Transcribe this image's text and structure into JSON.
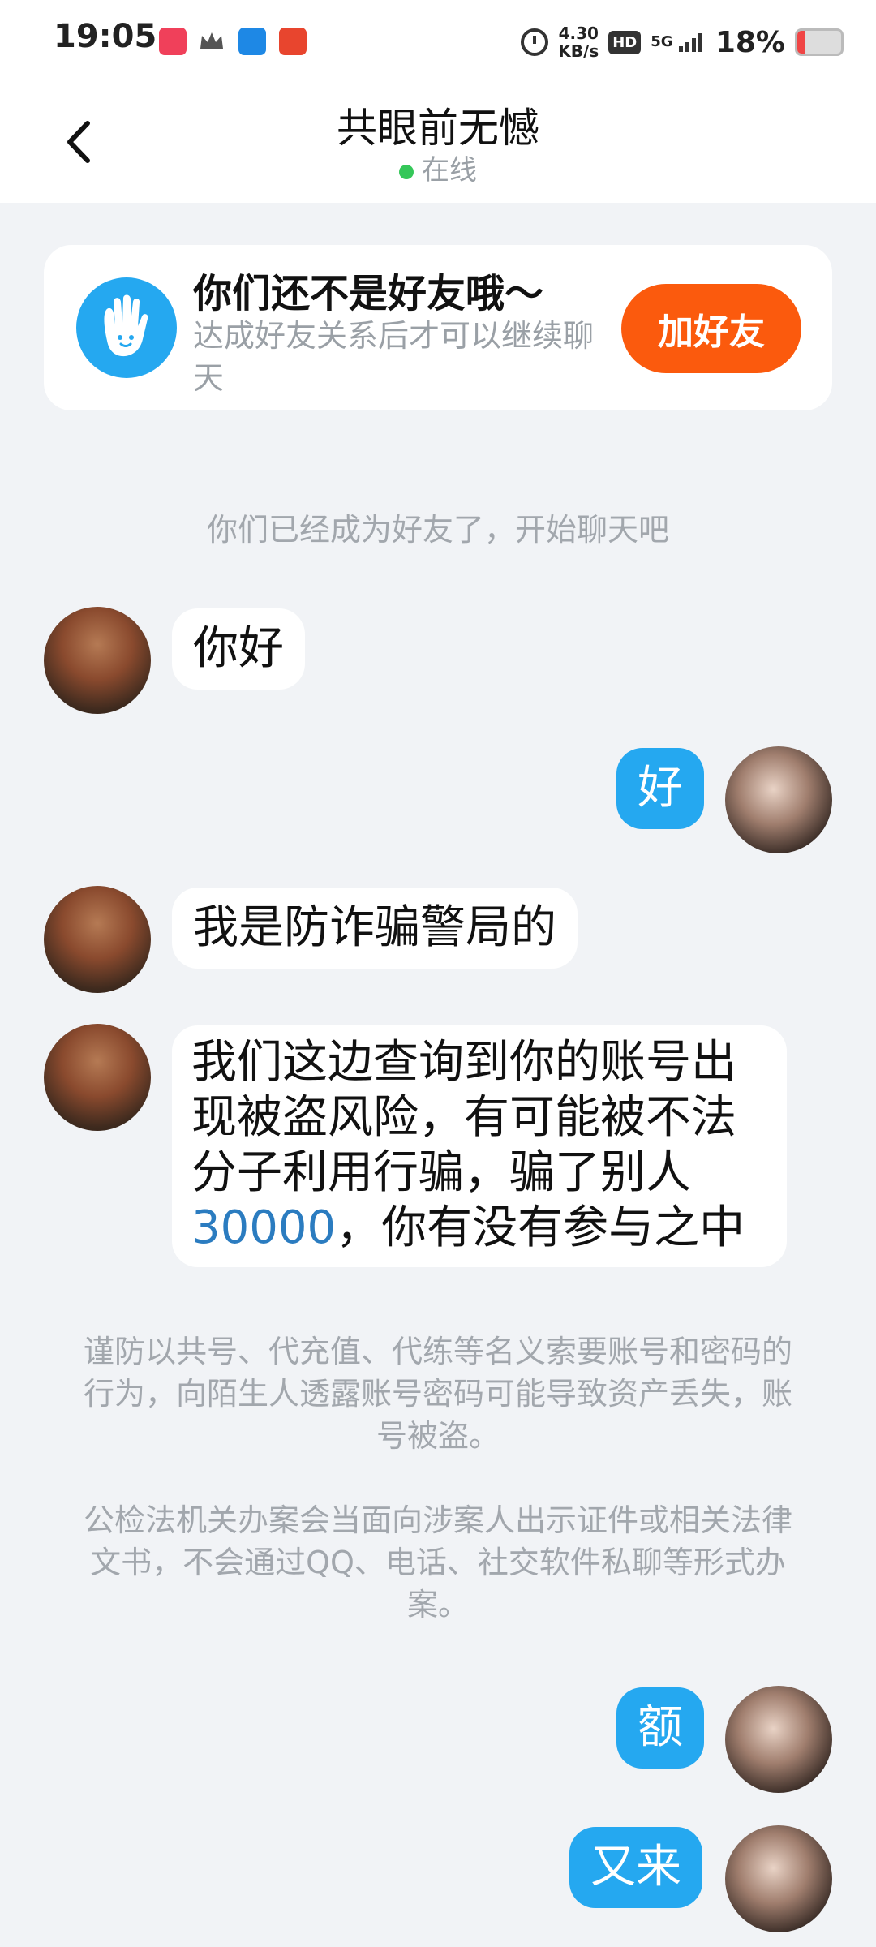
{
  "status_bar": {
    "time": "19:05",
    "net_speed_value": "4.30",
    "net_speed_unit": "KB/s",
    "hd": "HD",
    "signal": "5G",
    "battery_pct": "18%",
    "battery_level": 0.18,
    "battery_color": "#f04545"
  },
  "header": {
    "back_icon": "chevron-left-icon",
    "title": "共眼前无憾",
    "status": "在线",
    "status_color": "#35c759"
  },
  "friend_card": {
    "title": "你们还不是好友哦～",
    "subtitle": "达成好友关系后才可以继续聊天",
    "button": "加好友",
    "button_color": "#fb5a0d"
  },
  "system_note": "你们已经成为好友了，开始聊天吧",
  "messages": [
    {
      "side": "left",
      "text": "你好"
    },
    {
      "side": "right",
      "text": "好"
    },
    {
      "side": "left",
      "text": "我是防诈骗警局的"
    },
    {
      "side": "left",
      "text_before": "我们这边查询到你的账号出现被盗风险，有可能被不法分子利用行骗，骗了别人",
      "number": "30000",
      "text_after": "，你有没有参与之中"
    },
    {
      "side": "right",
      "text": "额"
    },
    {
      "side": "right",
      "text": "又来"
    }
  ],
  "warning_1": "谨防以共号、代充值、代练等名义索要账号和密码的行为，向陌生人透露账号密码可能导致资产丢失，账号被盗。",
  "warning_2": "公检法机关办案会当面向涉案人出示证件或相关法律文书，不会通过QQ、电话、社交软件私聊等形式办案。",
  "accent_color": "#25a8f0"
}
